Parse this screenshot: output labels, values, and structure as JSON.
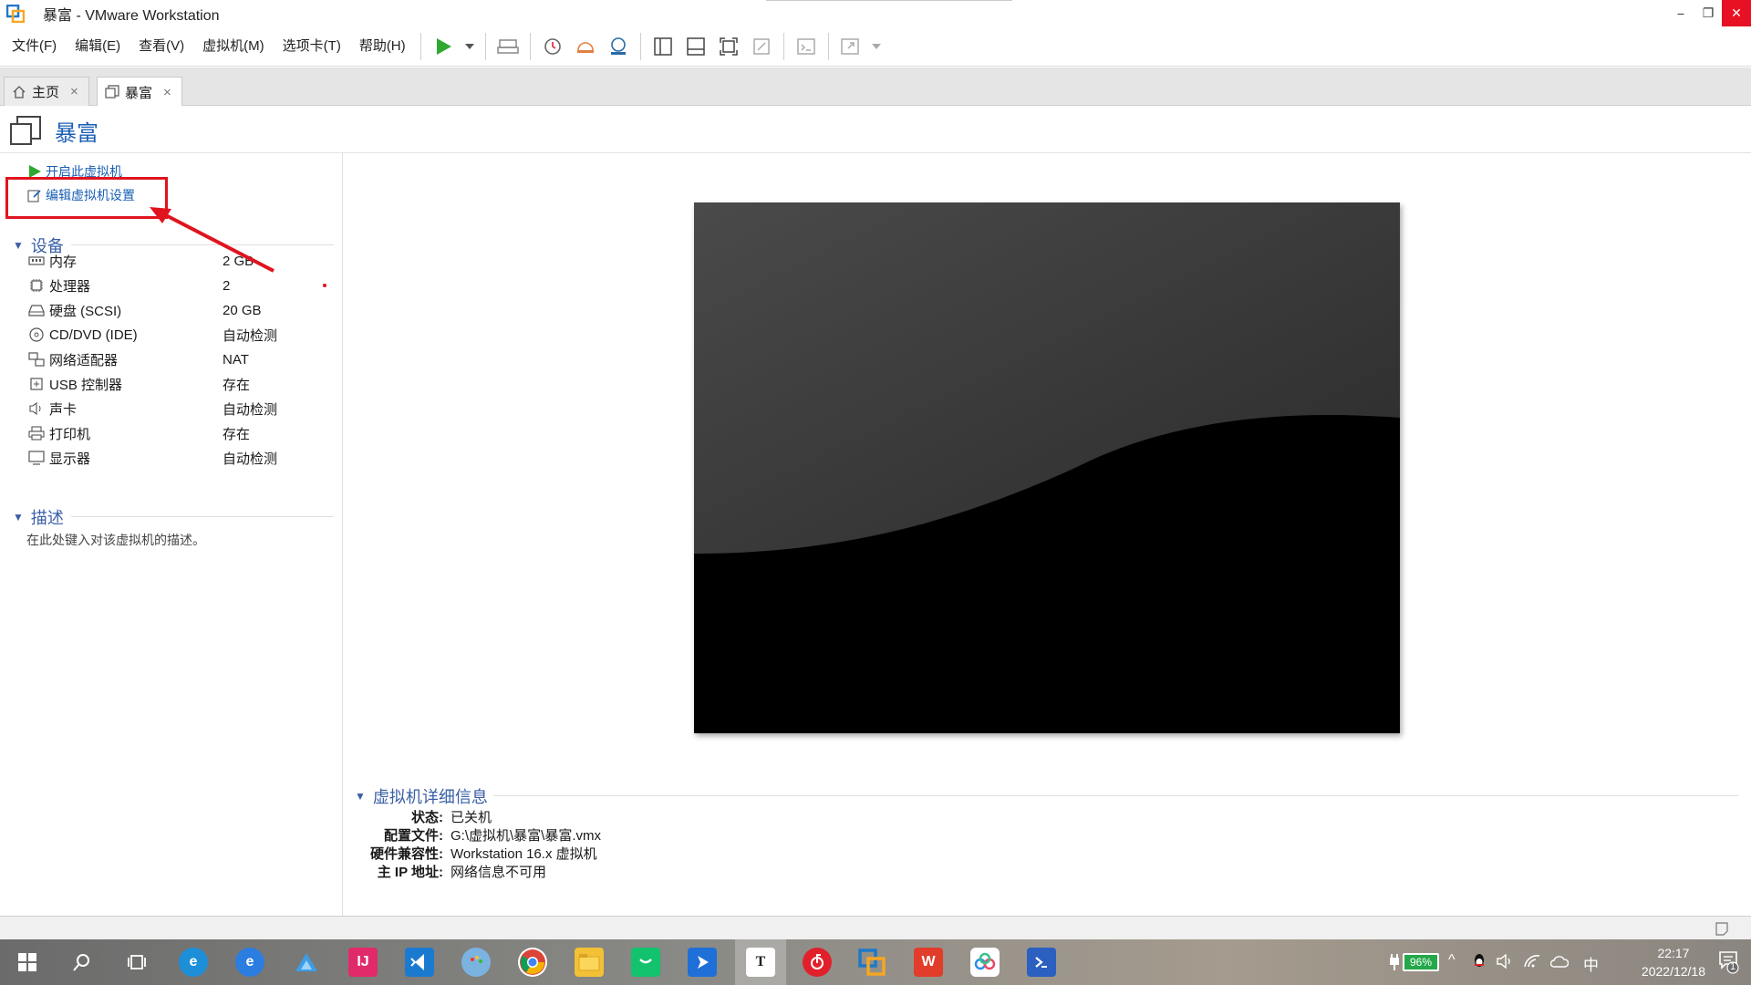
{
  "window": {
    "title": "暴富 - VMware Workstation",
    "controls": {
      "minimize": "−",
      "restore": "❐",
      "close": "✕"
    }
  },
  "menu": [
    "文件(F)",
    "编辑(E)",
    "查看(V)",
    "虚拟机(M)",
    "选项卡(T)",
    "帮助(H)"
  ],
  "tabs": [
    {
      "label": "主页",
      "close": "×"
    },
    {
      "label": "暴富",
      "close": "×"
    }
  ],
  "vm": {
    "name": "暴富",
    "actions": {
      "power_on": "开启此虚拟机",
      "edit_settings": "编辑虚拟机设置"
    },
    "devices_header": "设备",
    "devices": [
      {
        "name": "内存",
        "value": "2 GB",
        "icon": "memory-icon"
      },
      {
        "name": "处理器",
        "value": "2",
        "icon": "cpu-icon"
      },
      {
        "name": "硬盘 (SCSI)",
        "value": "20 GB",
        "icon": "harddisk-icon"
      },
      {
        "name": "CD/DVD (IDE)",
        "value": "自动检测",
        "icon": "cdrom-icon"
      },
      {
        "name": "网络适配器",
        "value": "NAT",
        "icon": "network-icon"
      },
      {
        "name": "USB 控制器",
        "value": "存在",
        "icon": "usb-icon"
      },
      {
        "name": "声卡",
        "value": "自动检测",
        "icon": "sound-icon"
      },
      {
        "name": "打印机",
        "value": "存在",
        "icon": "printer-icon"
      },
      {
        "name": "显示器",
        "value": "自动检测",
        "icon": "display-icon"
      }
    ],
    "description_header": "描述",
    "description_placeholder": "在此处键入对该虚拟机的描述。",
    "details_header": "虚拟机详细信息",
    "details": [
      {
        "key": "状态:",
        "value": "已关机"
      },
      {
        "key": "配置文件:",
        "value": "G:\\虚拟机\\暴富\\暴富.vmx"
      },
      {
        "key": "硬件兼容性:",
        "value": "Workstation 16.x 虚拟机"
      },
      {
        "key": "主 IP 地址:",
        "value": "网络信息不可用"
      }
    ]
  },
  "taskbar": {
    "battery": "96%",
    "ime": "中",
    "time": "22:17",
    "date": "2022/12/18",
    "notifications": "1"
  },
  "colors": {
    "accent": "#1a5fb4",
    "annotation": "#e0141e",
    "close": "#e81123"
  }
}
